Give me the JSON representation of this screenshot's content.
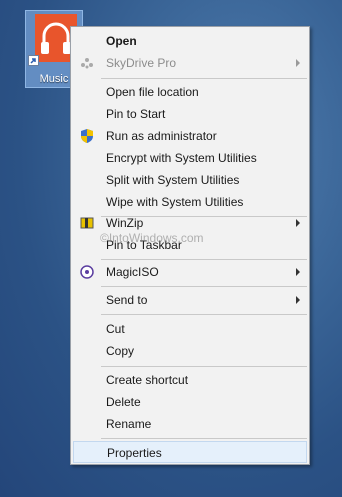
{
  "desktop": {
    "shortcut_label": "Music"
  },
  "watermark": "©IntoWindows.com",
  "menu": {
    "open": "Open",
    "skydrive": "SkyDrive Pro",
    "open_file_location": "Open file location",
    "pin_to_start": "Pin to Start",
    "run_as_admin": "Run as administrator",
    "encrypt": "Encrypt with System Utilities",
    "split": "Split with System Utilities",
    "wipe": "Wipe with System Utilities",
    "winzip": "WinZip",
    "pin_to_taskbar": "Pin to Taskbar",
    "magiciso": "MagicISO",
    "send_to": "Send to",
    "cut": "Cut",
    "copy": "Copy",
    "create_shortcut": "Create shortcut",
    "delete": "Delete",
    "rename": "Rename",
    "properties": "Properties"
  },
  "colors": {
    "music_tile": "#e8552c",
    "hover_background": "#e5f0fb"
  }
}
